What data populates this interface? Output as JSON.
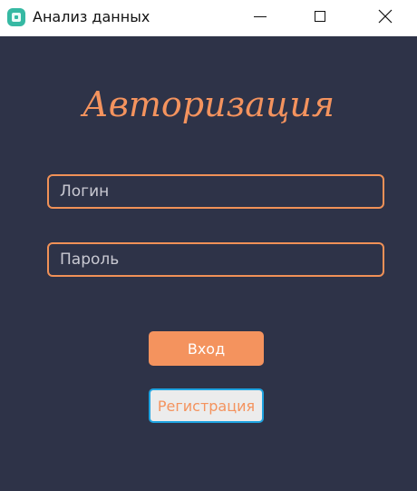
{
  "window": {
    "title": "Анализ данных",
    "icon": "app-icon",
    "controls": {
      "minimize_icon": "minimize-icon",
      "maximize_icon": "maximize-icon",
      "close_icon": "close-icon"
    }
  },
  "form": {
    "heading": "Авторизация",
    "login": {
      "placeholder": "Логин",
      "value": ""
    },
    "password": {
      "placeholder": "Пароль",
      "value": ""
    },
    "enter_label": "Вход",
    "register_label": "Регистрация"
  },
  "colors": {
    "background": "#2e3348",
    "accent": "#f4935e",
    "focus_border": "#1fa3e0"
  }
}
